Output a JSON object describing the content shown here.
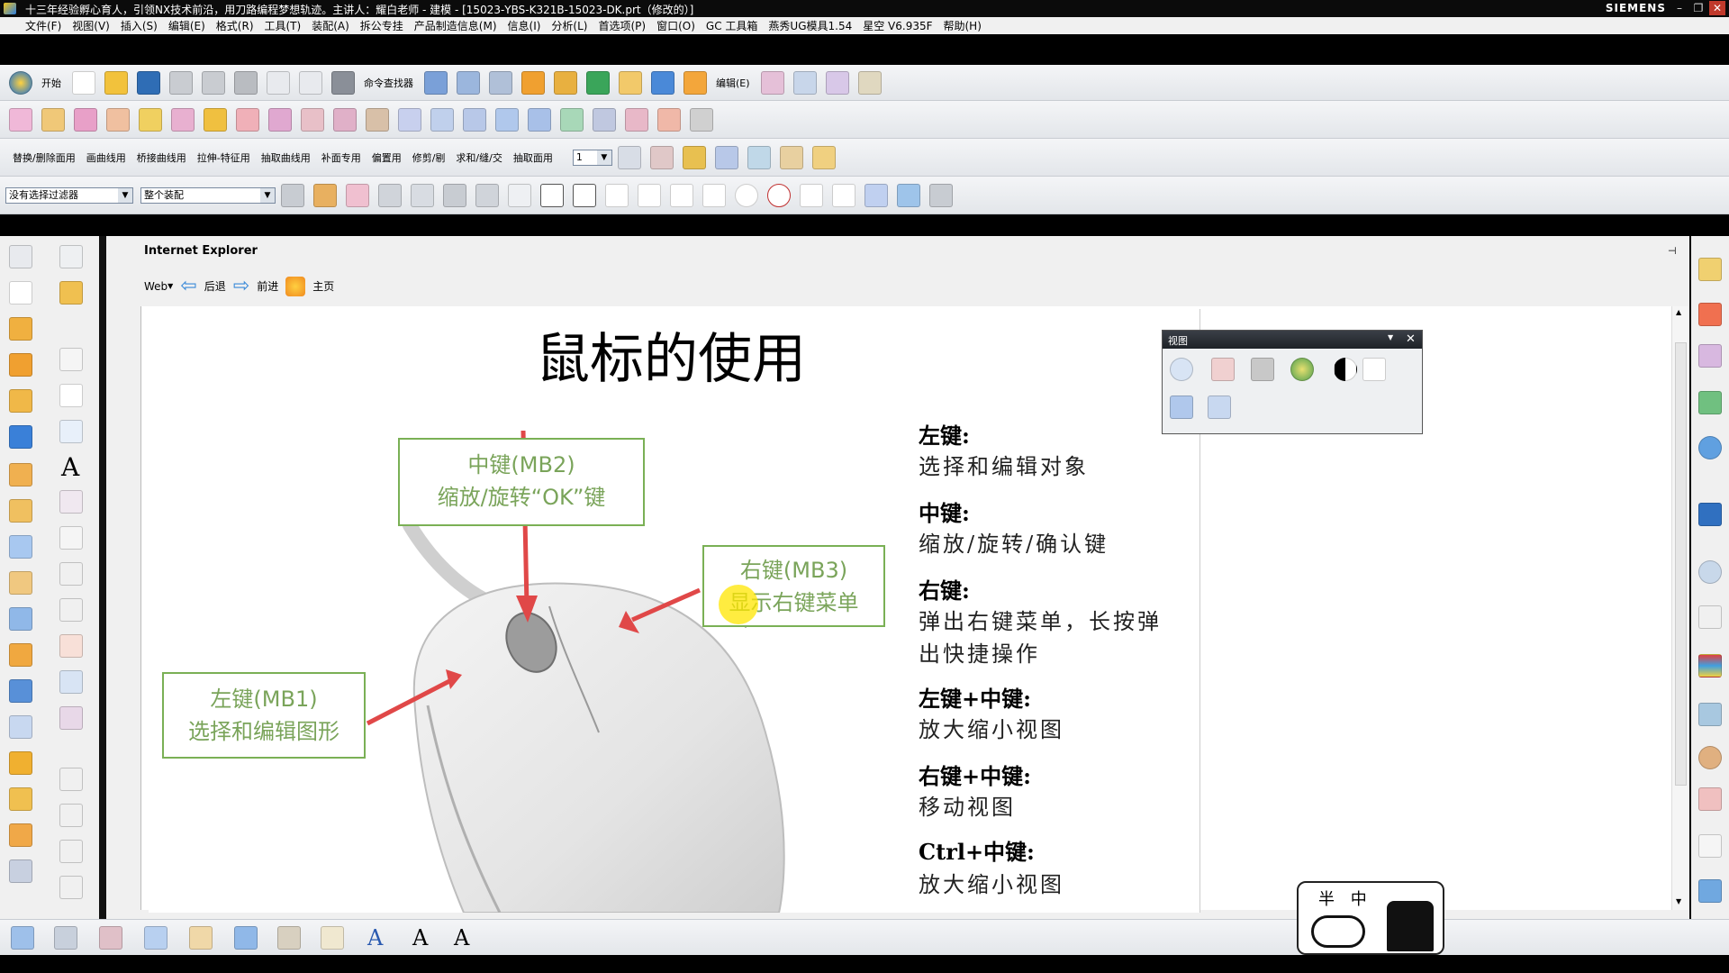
{
  "window": {
    "title": "十三年经验孵心育人，引领NX技术前沿，用刀路编程梦想轨迹。主讲人：耀白老师 - 建模 - [15023-YBS-K321B-15023-DK.prt（修改的）]",
    "brand": "SIEMENS",
    "controls": [
      "–",
      "❐",
      "✕"
    ]
  },
  "menu": {
    "items": [
      "文件(F)",
      "视图(V)",
      "插入(S)",
      "编辑(E)",
      "格式(R)",
      "工具(T)",
      "装配(A)",
      "拆公专挂",
      "产品制造信息(M)",
      "信息(I)",
      "分析(L)",
      "首选项(P)",
      "窗口(O)",
      "GC 工具箱",
      "燕秀UG模具1.54",
      "星空 V6.935F",
      "帮助(H)"
    ]
  },
  "toolbar1": {
    "start_label": "开始",
    "command_finder_label": "命令查找器",
    "edit_label": "编辑(E)"
  },
  "toolbar3": {
    "items": [
      "替换/删除面用",
      "画曲线用",
      "桥接曲线用",
      "拉伸-特征用",
      "抽取曲线用",
      "补面专用",
      "偏置用",
      "修剪/剔",
      "求和/缝/交",
      "抽取面用"
    ],
    "layer_value": "1"
  },
  "toolbar4": {
    "filter_value": "没有选择过滤器",
    "scope_value": "整个装配"
  },
  "browser": {
    "title": "Internet Explorer",
    "web_label": "Web",
    "back_label": "后退",
    "forward_label": "前进",
    "home_label": "主页",
    "pin": "⊣"
  },
  "slide": {
    "title": "鼠标的使用",
    "callouts": {
      "mb2_line1": "中键(MB2)",
      "mb2_line2": "缩放/旋转“OK”键",
      "mb3_line1": "右键(MB3)",
      "mb3_line2": "显示右键菜单",
      "mb1_line1": "左键(MB1)",
      "mb1_line2": "选择和编辑图形"
    },
    "notes": [
      {
        "head": "左键:",
        "body": [
          "选择和编辑对象"
        ]
      },
      {
        "head": "中键:",
        "body": [
          "缩放/旋转/确认键"
        ]
      },
      {
        "head": "右键:",
        "body": [
          "弹出右键菜单，长按弹",
          "出快捷操作"
        ]
      },
      {
        "head": "左键+中键:",
        "body": [
          "放大缩小视图"
        ]
      },
      {
        "head": "右键+中键:",
        "body": [
          "移动视图"
        ]
      },
      {
        "head": "Ctrl+中键:",
        "body": [
          "放大缩小视图"
        ]
      }
    ]
  },
  "view_panel": {
    "title": "视图",
    "close": "✕"
  },
  "logo": {
    "text": "半 中"
  },
  "colors": {
    "callout_border": "#7ab055",
    "callout_text": "#7aa45a",
    "arrow": "#e04848",
    "highlight": "#ffe600"
  }
}
